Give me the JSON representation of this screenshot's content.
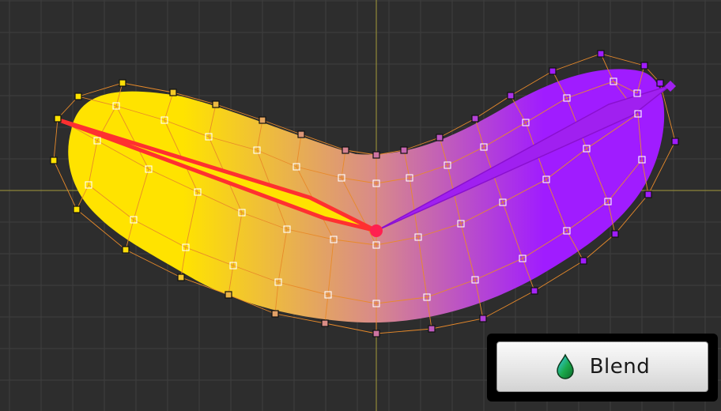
{
  "tool": {
    "button_label": "Blend",
    "icon": "droplet-icon"
  },
  "colors": {
    "background": "#2d2d2d",
    "grid_line": "#3e3e3e",
    "axis_line": "#a59a3a",
    "mesh_line": "#e88a2a",
    "gradient_start": "#ffe300",
    "gradient_end": "#a01cff",
    "bone_warm": "#ff3030",
    "bone_cool": "#a020f0"
  }
}
